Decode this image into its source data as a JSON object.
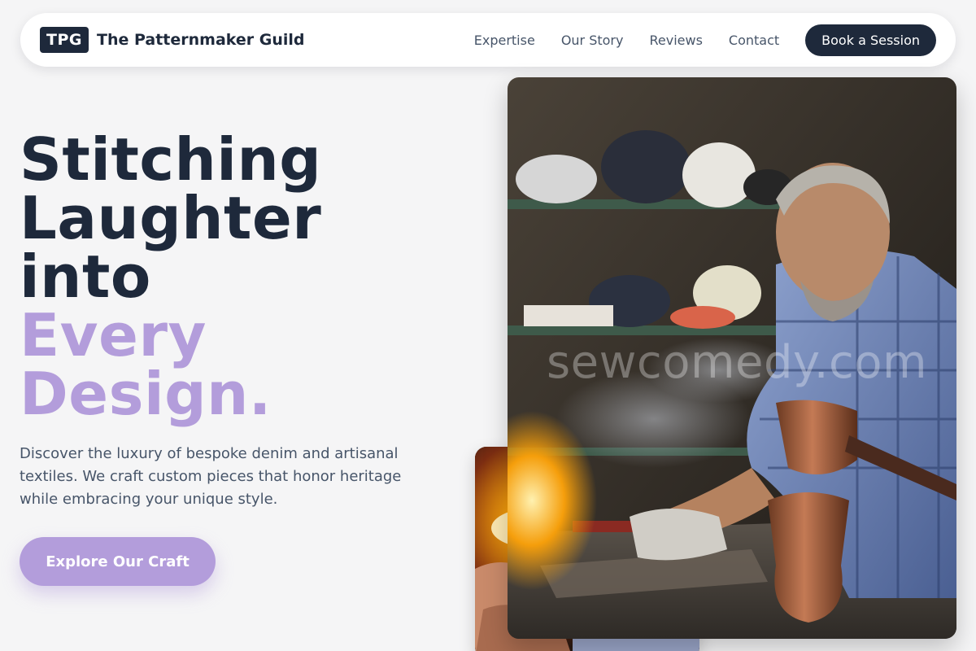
{
  "nav": {
    "logo_badge": "TPG",
    "brand_name": "The Patternmaker Guild",
    "links": [
      "Expertise",
      "Our Story",
      "Reviews",
      "Contact"
    ],
    "cta_label": "Book a Session"
  },
  "hero": {
    "title_lines": [
      "Stitching",
      "Laughter",
      "into"
    ],
    "title_accent_lines": [
      "Every",
      "Design."
    ],
    "subtitle": "Discover the luxury of bespoke denim and artisanal textiles. We craft custom pieces that honor heritage while embracing your unique style.",
    "button_label": "Explore Our Craft"
  },
  "images": {
    "main_watermark": "sewcomedy.com",
    "main_alt": "Craftsman with grey hair in plaid shirt working copper vessel over smoky fire",
    "small_alt": "Hands working near flames in workshop"
  },
  "colors": {
    "primary_dark": "#1e293b",
    "accent_lavender": "#b39ddb",
    "background": "#f5f5f6"
  }
}
